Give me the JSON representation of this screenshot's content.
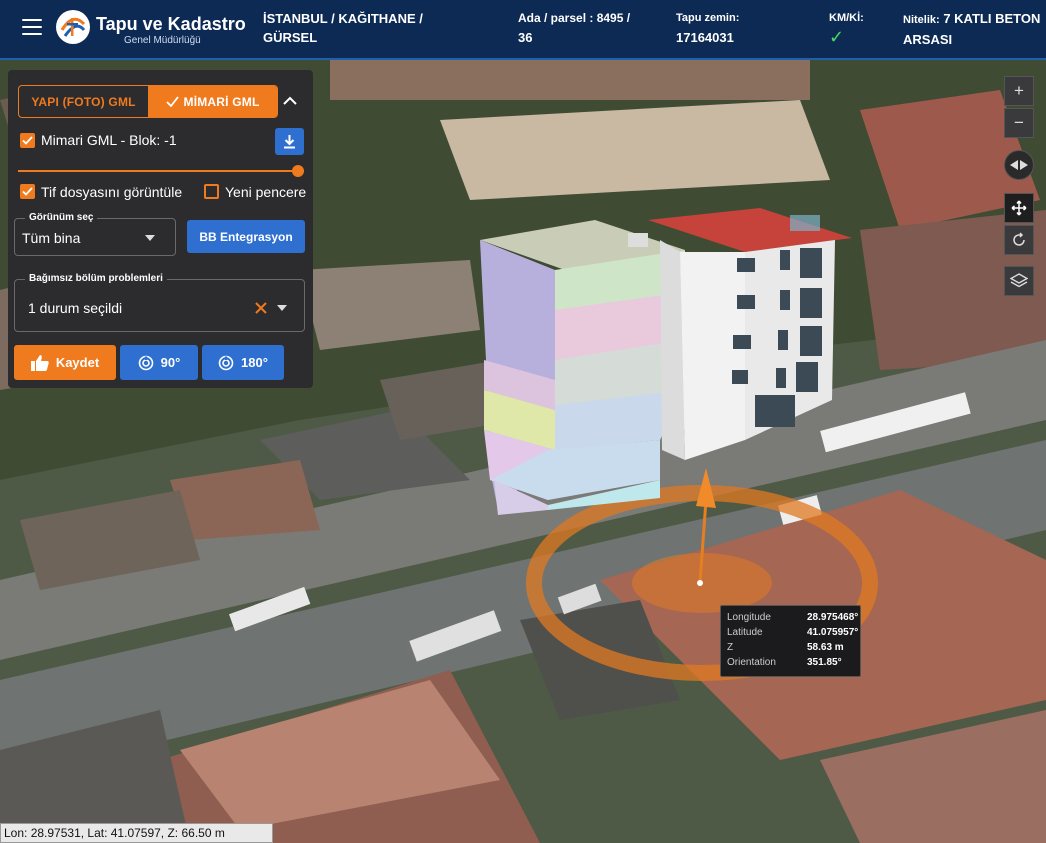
{
  "header": {
    "logo_title": "Tapu ve Kadastro",
    "logo_subtitle": "Genel Müdürlüğü",
    "location_line1": "İSTANBUL / KAĞITHANE /",
    "location_line2": "GÜRSEL",
    "ada_label": "Ada / parsel : 8495 /",
    "ada_value": "36",
    "tapu_label": "Tapu zemin:",
    "tapu_value": "17164031",
    "kmki_label": "KM/Kİ:",
    "kmki_value": "✓",
    "nitelik_label": "Nitelik:",
    "nitelik_value1": "7 KATLI BETON",
    "nitelik_value2": "ARSASI"
  },
  "panel": {
    "tab_foto": "YAPI (FOTO) GML",
    "tab_mimari": "MİMARİ GML",
    "mimari_checkbox": "Mimari GML - Blok: -1",
    "opacity": 1.0,
    "tif_checkbox": "Tif dosyasını görüntüle",
    "new_window_checkbox": "Yeni pencere",
    "view_legend": "Görünüm seç",
    "view_value": "Tüm bina",
    "bb_button": "BB Entegrasyon",
    "problems_legend": "Bağımsız bölüm problemleri",
    "problems_value": "1 durum seçildi",
    "save_button": "Kaydet",
    "rotate90_button": "90°",
    "rotate180_button": "180°"
  },
  "toolbar": {
    "zoom_in": "+",
    "zoom_out": "−"
  },
  "info": {
    "longitude_label": "Longitude",
    "longitude_value": "28.975468°",
    "latitude_label": "Latitude",
    "latitude_value": "41.075957°",
    "z_label": "Z",
    "z_value": "58.63 m",
    "orientation_label": "Orientation",
    "orientation_value": "351.85°"
  },
  "status": {
    "coords": "Lon: 28.97531, Lat: 41.07597, Z: 66.50 m"
  },
  "colors": {
    "accent": "#f07a1e",
    "primary": "#2e6fd0",
    "header": "#0d2a55"
  }
}
